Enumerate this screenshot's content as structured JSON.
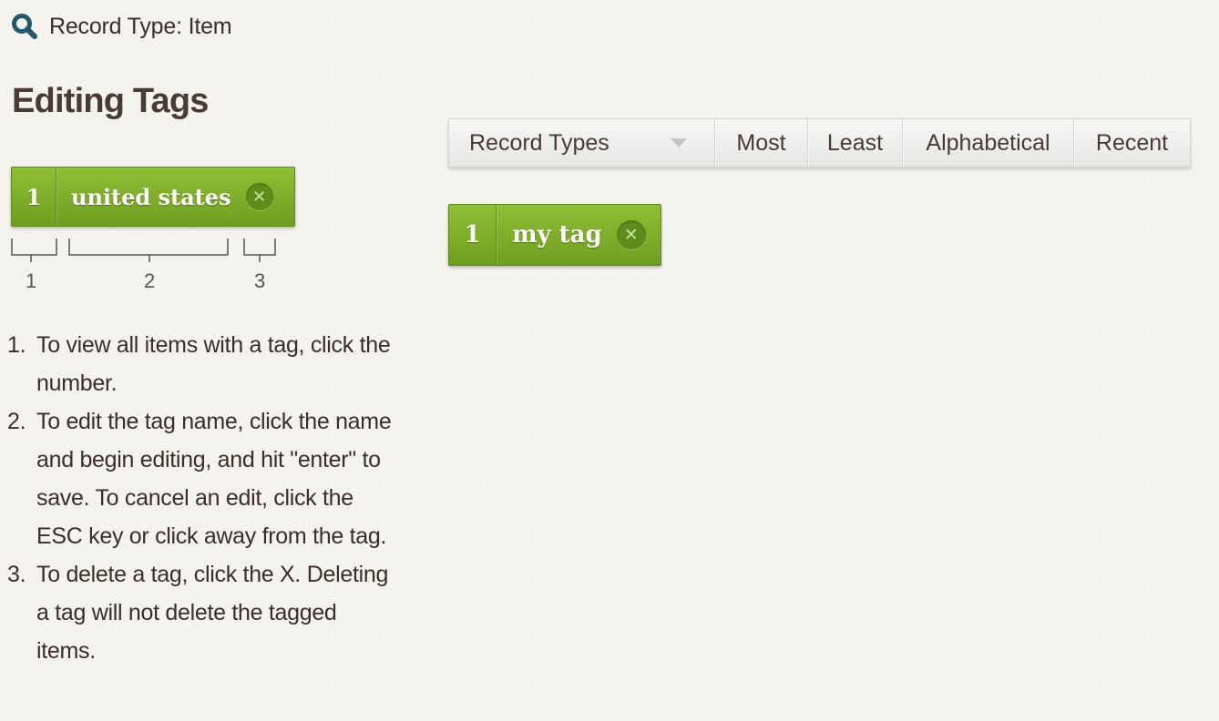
{
  "header": {
    "search_icon": "magnifier-icon",
    "record_type_label": "Record Type: Item"
  },
  "help": {
    "title": "Editing Tags",
    "example_tag": {
      "count": "1",
      "name": "united states",
      "delete_icon": "circle-x-icon"
    },
    "diagram_numbers": [
      "1",
      "2",
      "3"
    ],
    "instructions": [
      {
        "num": "1.",
        "text": "To view all items with a tag, click the number."
      },
      {
        "num": "2.",
        "text": "To edit the tag name, click the name and begin editing, and hit \"enter\" to save. To cancel an edit, click the ESC key or click away from the tag."
      },
      {
        "num": "3.",
        "text": "To delete a tag, click the X. Deleting a tag will not delete the tagged items."
      }
    ]
  },
  "sort_bar": {
    "record_types_select": "Record Types",
    "options": [
      "Most",
      "Least",
      "Alphabetical",
      "Recent"
    ]
  },
  "tags": [
    {
      "count": "1",
      "name": "my tag",
      "delete_icon": "circle-x-icon"
    }
  ],
  "colors": {
    "tag_green": "#7fae2a",
    "text_brown": "#3b2e2a",
    "icon_teal": "#1e5a6b"
  }
}
